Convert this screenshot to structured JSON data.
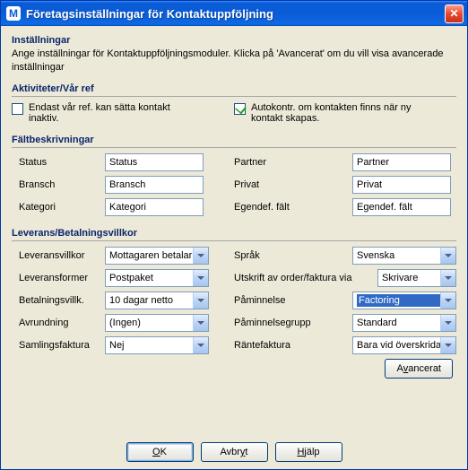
{
  "titlebar": {
    "icon_letter": "M",
    "title": "Företagsinställningar för Kontaktuppföljning",
    "close_label": "✕"
  },
  "header": {
    "title": "Inställningar",
    "desc": "Ange inställningar för Kontaktuppföljningsmoduler. Klicka på 'Avancerat' om du vill visa avancerade inställningar"
  },
  "groups": {
    "activities": {
      "title": "Aktiviteter/Vår ref",
      "left_checkbox": {
        "label": "Endast vår ref. kan sätta kontakt inaktiv.",
        "checked": false
      },
      "right_checkbox": {
        "label": "Autokontr. om kontakten finns när ny kontakt skapas.",
        "checked": true
      }
    },
    "field_desc": {
      "title": "Fältbeskrivningar",
      "rows": [
        {
          "label": "Status",
          "value": "Status",
          "r_label": "Partner",
          "r_value": "Partner"
        },
        {
          "label": "Bransch",
          "value": "Bransch",
          "r_label": "Privat",
          "r_value": "Privat"
        },
        {
          "label": "Kategori",
          "value": "Kategori",
          "r_label": "Egendef. fält",
          "r_value": "Egendef. fält"
        }
      ]
    },
    "delivery": {
      "title": "Leverans/Betalningsvillkor",
      "left": [
        {
          "label": "Leveransvillkor",
          "value": "Mottagaren betalar"
        },
        {
          "label": "Leveransformer",
          "value": "Postpaket"
        },
        {
          "label": "Betalningsvillk.",
          "value": "10 dagar netto"
        },
        {
          "label": "Avrundning",
          "value": "(Ingen)"
        },
        {
          "label": "Samlingsfaktura",
          "value": "Nej"
        }
      ],
      "right": [
        {
          "label": "Språk",
          "value": "Svenska"
        },
        {
          "label": "Utskrift av order/faktura via",
          "value": "Skrivare"
        },
        {
          "label": "Påminnelse",
          "value": "Factoring",
          "selected": true
        },
        {
          "label": "Påminnelsegrupp",
          "value": "Standard"
        },
        {
          "label": "Räntefaktura",
          "value": "Bara vid överskridande"
        }
      ],
      "advanced_prefix": "A",
      "advanced_underline": "v",
      "advanced_suffix": "ancerat"
    }
  },
  "buttons": {
    "ok_u": "O",
    "ok_rest": "K",
    "cancel_pre": "Avbr",
    "cancel_u": "y",
    "cancel_post": "t",
    "help_u": "H",
    "help_rest": "jälp"
  }
}
